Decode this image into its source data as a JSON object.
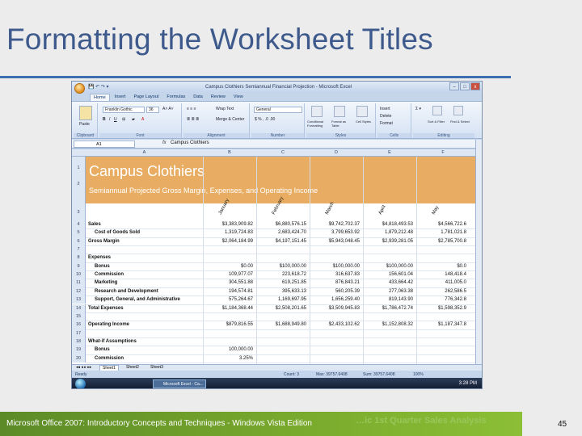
{
  "slide": {
    "title": "Formatting the Worksheet Titles",
    "footer": "Microsoft Office 2007: Introductory Concepts and Techniques - Windows Vista Edition",
    "footer_ghost": "…ic 1st Quarter Sales Analysis",
    "page_number": "45"
  },
  "window": {
    "title": "Campus Clothiers Semiannual Financial Projection - Microsoft Excel",
    "buttons": [
      "–",
      "□",
      "x"
    ]
  },
  "ribbon": {
    "tabs": [
      "Home",
      "Insert",
      "Page Layout",
      "Formulas",
      "Data",
      "Review",
      "View"
    ],
    "font_name": "Franklin Gothic",
    "font_size": "36",
    "number_format": "General",
    "groups": [
      "Clipboard",
      "Font",
      "Alignment",
      "Number",
      "Styles",
      "Cells",
      "Editing"
    ],
    "paste_label": "Paste",
    "wrap_text": "Wrap Text",
    "merge_center": "Merge & Center",
    "conditional_formatting": "Conditional Formatting",
    "format_as_table": "Format as Table",
    "cell_styles": "Cell Styles",
    "insert": "Insert",
    "delete": "Delete",
    "format": "Format",
    "sort_filter": "Sort & Filter",
    "find_select": "Find & Select"
  },
  "formula_bar": {
    "name_box": "A1",
    "fx": "fx",
    "content": "Campus Clothiers"
  },
  "sheet": {
    "columns": [
      "A",
      "B",
      "C",
      "D",
      "E",
      "F"
    ],
    "title": "Campus Clothiers",
    "subtitle": "Semiannual Projected Gross Margin, Expenses, and Operating Income",
    "months": [
      "January",
      "February",
      "March",
      "April",
      "May"
    ],
    "rows": [
      {
        "n": "4",
        "label": "Sales",
        "bold": true,
        "values": [
          "$3,383,909.82",
          "$6,880,576.15",
          "$9,742,702.37",
          "$4,818,493.53",
          "$4,566,722.6"
        ]
      },
      {
        "n": "5",
        "label": "Cost of Goods Sold",
        "bold": true,
        "indent": true,
        "values": [
          "1,319,724.83",
          "2,683,424.70",
          "3,799,653.92",
          "1,879,212.48",
          "1,781,021.8"
        ]
      },
      {
        "n": "6",
        "label": "Gross Margin",
        "bold": true,
        "values": [
          "$2,064,184.99",
          "$4,197,151.45",
          "$5,943,048.45",
          "$2,939,281.05",
          "$2,785,700.8"
        ]
      },
      {
        "n": "7",
        "label": "",
        "values": [
          "",
          "",
          "",
          "",
          ""
        ]
      },
      {
        "n": "8",
        "label": "Expenses",
        "bold": true,
        "values": [
          "",
          "",
          "",
          "",
          ""
        ]
      },
      {
        "n": "9",
        "label": "Bonus",
        "bold": true,
        "indent": true,
        "values": [
          "$0.00",
          "$100,000.00",
          "$100,000.00",
          "$100,000.00",
          "$0.0"
        ]
      },
      {
        "n": "10",
        "label": "Commission",
        "bold": true,
        "indent": true,
        "values": [
          "109,977.07",
          "223,618.72",
          "316,637.83",
          "156,601.04",
          "148,418.4"
        ]
      },
      {
        "n": "11",
        "label": "Marketing",
        "bold": true,
        "indent": true,
        "values": [
          "304,551.88",
          "619,251.85",
          "876,843.21",
          "433,664.42",
          "411,005.0"
        ]
      },
      {
        "n": "12",
        "label": "Research and Development",
        "bold": true,
        "indent": true,
        "values": [
          "194,574.81",
          "395,633.13",
          "560,205.39",
          "277,063.38",
          "262,586.5"
        ]
      },
      {
        "n": "13",
        "label": "Support, General, and Administrative",
        "bold": true,
        "indent": true,
        "values": [
          "575,264.67",
          "1,169,697.95",
          "1,656,259.40",
          "819,143.90",
          "776,342.8"
        ]
      },
      {
        "n": "14",
        "label": "Total Expenses",
        "bold": true,
        "values": [
          "$1,184,368.44",
          "$2,508,201.65",
          "$3,509,945.83",
          "$1,786,472.74",
          "$1,598,352.9"
        ]
      },
      {
        "n": "15",
        "label": "",
        "values": [
          "",
          "",
          "",
          "",
          ""
        ]
      },
      {
        "n": "16",
        "label": "Operating Income",
        "bold": true,
        "values": [
          "$879,816.55",
          "$1,688,949.80",
          "$2,433,102.62",
          "$1,152,808.32",
          "$1,187,347.8"
        ]
      },
      {
        "n": "17",
        "label": "",
        "values": [
          "",
          "",
          "",
          "",
          ""
        ]
      },
      {
        "n": "18",
        "label": "What-if Assumptions",
        "bold": true,
        "values": [
          "",
          "",
          "",
          "",
          ""
        ]
      },
      {
        "n": "19",
        "label": "Bonus",
        "bold": true,
        "indent": true,
        "values": [
          "100,000.00",
          "",
          "",
          "",
          ""
        ]
      },
      {
        "n": "20",
        "label": "Commission",
        "bold": true,
        "indent": true,
        "values": [
          "3.25%",
          "",
          "",
          "",
          ""
        ]
      }
    ],
    "tabs": [
      "Sheet1",
      "Sheet2",
      "Sheet3"
    ]
  },
  "status": {
    "ready": "Ready",
    "count": "Count: 3",
    "max": "Max: 39757.6408",
    "sum": "Sum: 39757.6408",
    "zoom": "100%"
  },
  "taskbar": {
    "item": "Microsoft Excel - Ca...",
    "clock": "3:28 PM"
  }
}
